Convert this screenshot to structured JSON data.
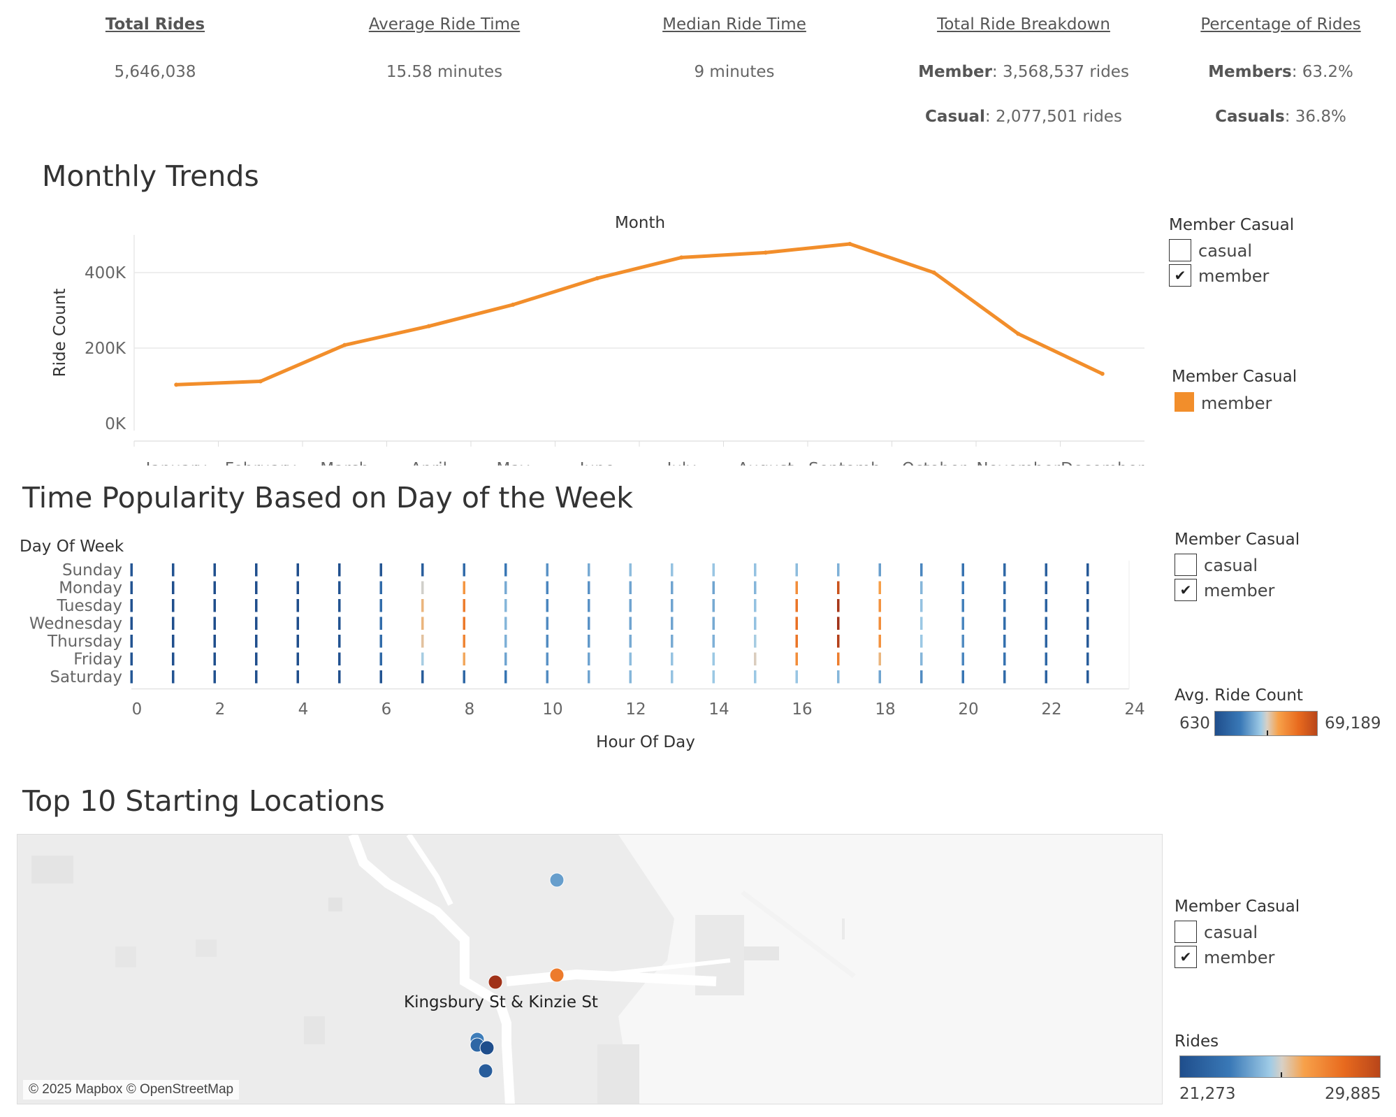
{
  "kpis": {
    "total_rides": {
      "label": "Total Rides",
      "value": "5,646,038"
    },
    "avg_ride": {
      "label": "Average Ride Time",
      "value": "15.58 minutes"
    },
    "median_ride": {
      "label": "Median Ride Time",
      "value": "9 minutes"
    },
    "breakdown": {
      "label": "Total Ride Breakdown",
      "member_key": "Member",
      "member_val": ": 3,568,537 rides",
      "casual_key": "Casual",
      "casual_val": ": 2,077,501 rides"
    },
    "percentage": {
      "label": "Percentage of Rides",
      "member_key": "Members",
      "member_val": ": 63.2%",
      "casual_key": "Casuals",
      "casual_val": ": 36.8%"
    }
  },
  "monthly": {
    "title": "Monthly Trends",
    "header": "Month",
    "ylabel": "Ride Count",
    "legend_filter": {
      "title": "Member Casual",
      "items": [
        {
          "label": "casual",
          "checked": ""
        },
        {
          "label": "member",
          "checked": "✔"
        }
      ]
    },
    "legend_color": {
      "title": "Member Casual",
      "item": "member",
      "color": "#f28e2b"
    }
  },
  "weekly": {
    "title": "Time Popularity Based on Day of the Week",
    "row_header": "Day Of Week",
    "xlabel": "Hour Of Day",
    "legend_filter": {
      "title": "Member Casual",
      "items": [
        {
          "label": "casual",
          "checked": ""
        },
        {
          "label": "member",
          "checked": "✔"
        }
      ]
    },
    "legend_color": {
      "title": "Avg. Ride Count",
      "min": "630",
      "max": "69,189"
    }
  },
  "locations": {
    "title": "Top 10 Starting Locations",
    "map_label": "Kingsbury St & Kinzie St",
    "attribution": "© 2025 Mapbox © OpenStreetMap",
    "legend_filter": {
      "title": "Member Casual",
      "items": [
        {
          "label": "casual",
          "checked": ""
        },
        {
          "label": "member",
          "checked": "✔"
        }
      ]
    },
    "legend_color": {
      "title": "Rides",
      "min": "21,273",
      "max": "29,885"
    }
  },
  "chart_data": [
    {
      "type": "line",
      "title": "Monthly Trends",
      "xlabel": "Month",
      "ylabel": "Ride Count",
      "categories": [
        "January",
        "February",
        "March",
        "April",
        "May",
        "June",
        "July",
        "August",
        "Septemb..",
        "October",
        "November",
        "December"
      ],
      "series": [
        {
          "name": "member",
          "color": "#f28e2b",
          "values": [
            103000,
            112000,
            208000,
            258000,
            315000,
            385000,
            440000,
            453000,
            476000,
            400000,
            238000,
            132000
          ]
        }
      ],
      "yticks": [
        "0K",
        "200K",
        "400K"
      ],
      "ylim": [
        0,
        500000
      ],
      "grid": true
    },
    {
      "type": "heatmap",
      "title": "Time Popularity Based on Day of the Week",
      "xlabel": "Hour Of Day",
      "ylabel": "Day Of Week",
      "rows": [
        "Sunday",
        "Monday",
        "Tuesday",
        "Wednesday",
        "Thursday",
        "Friday",
        "Saturday"
      ],
      "x": [
        0,
        1,
        2,
        3,
        4,
        5,
        6,
        7,
        8,
        9,
        10,
        11,
        12,
        13,
        14,
        15,
        16,
        17,
        18,
        19,
        20,
        21,
        22,
        23
      ],
      "xticks": [
        0,
        2,
        4,
        6,
        8,
        10,
        12,
        14,
        16,
        18,
        20,
        22,
        24
      ],
      "color_range": [
        630,
        69189
      ],
      "values": [
        [
          4000,
          2500,
          1500,
          900,
          700,
          1200,
          3500,
          7000,
          12000,
          17000,
          22000,
          26000,
          29000,
          30000,
          30500,
          30000,
          29000,
          27000,
          24000,
          20000,
          15000,
          11000,
          8000,
          5000
        ],
        [
          2500,
          1200,
          700,
          650,
          800,
          2500,
          12000,
          35000,
          46000,
          26000,
          20000,
          22000,
          25000,
          25000,
          25000,
          28000,
          48000,
          62000,
          44000,
          28000,
          18000,
          12000,
          8000,
          4500
        ],
        [
          2200,
          1100,
          700,
          630,
          800,
          2600,
          13000,
          40000,
          52000,
          28000,
          20000,
          22000,
          25000,
          25000,
          26000,
          30000,
          54000,
          68000,
          47000,
          30000,
          19000,
          13000,
          8500,
          4500
        ],
        [
          2300,
          1100,
          700,
          640,
          800,
          2600,
          13000,
          40000,
          53000,
          28000,
          21000,
          22000,
          25000,
          25000,
          26000,
          30000,
          55000,
          69189,
          48000,
          31000,
          20000,
          13000,
          9000,
          5000
        ],
        [
          2600,
          1200,
          750,
          680,
          820,
          2500,
          12500,
          38000,
          50000,
          27000,
          21000,
          23000,
          26000,
          26000,
          27000,
          32000,
          54000,
          66000,
          47000,
          31000,
          21000,
          14000,
          9500,
          5500
        ],
        [
          3000,
          1500,
          900,
          750,
          850,
          2300,
          11000,
          32000,
          42000,
          25000,
          22000,
          25000,
          29000,
          30000,
          31000,
          36000,
          48000,
          52000,
          40000,
          28000,
          20000,
          15000,
          11000,
          7000
        ],
        [
          4500,
          3000,
          1800,
          1100,
          800,
          1100,
          3000,
          6500,
          11000,
          16000,
          21000,
          25000,
          28000,
          30000,
          31000,
          31000,
          30500,
          28000,
          25000,
          21000,
          16000,
          12000,
          9000,
          6000
        ]
      ]
    }
  ],
  "map_points": [
    {
      "value": 24200
    },
    {
      "value": 27800
    },
    {
      "value": 29885
    },
    {
      "value": 23500
    },
    {
      "value": 22500
    },
    {
      "value": 21273
    },
    {
      "value": 22000
    }
  ]
}
